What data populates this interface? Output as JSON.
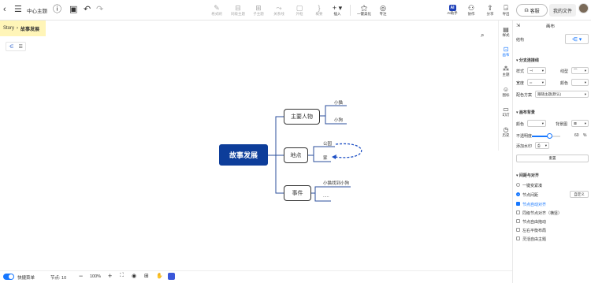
{
  "topbar": {
    "doc_title": "中心主题",
    "tools": [
      {
        "label": "格式刷",
        "enabled": false
      },
      {
        "label": "同级主题",
        "enabled": false
      },
      {
        "label": "子主题",
        "enabled": false
      },
      {
        "label": "关系线",
        "enabled": false
      },
      {
        "label": "外框",
        "enabled": false
      },
      {
        "label": "概要",
        "enabled": false
      },
      {
        "label": "插入",
        "enabled": true
      },
      {
        "label": "一键美化",
        "enabled": true
      },
      {
        "label": "专注",
        "enabled": true
      }
    ],
    "ai_label": "AI助手",
    "ai_badge": "AI",
    "collab_label": "协作",
    "share_label": "分享",
    "export_label": "导出",
    "share_btn": "客服",
    "files_btn": "我的文件"
  },
  "breadcrumb": {
    "root": "Story",
    "current": "故事发展"
  },
  "mindmap": {
    "root": "故事发展",
    "branches": [
      {
        "label": "主要人物",
        "children": [
          "小猫",
          "小狗"
        ]
      },
      {
        "label": "地点",
        "children": [
          "公园",
          "家"
        ]
      },
      {
        "label": "事件",
        "children": [
          "小猫找到小狗",
          "....."
        ]
      }
    ]
  },
  "right_tabs": [
    {
      "label": "样式",
      "active": false
    },
    {
      "label": "画布",
      "active": true
    },
    {
      "label": "主题",
      "active": false
    },
    {
      "label": "图标",
      "active": false
    },
    {
      "label": "幻灯",
      "active": false
    },
    {
      "label": "历史",
      "active": false
    }
  ],
  "panel": {
    "title": "画布",
    "structure_label": "结构",
    "branch_section": "分支连接线",
    "style_label": "样式",
    "line_label": "线型",
    "width_label": "宽度",
    "color_label": "颜色",
    "scheme_label": "配色方案",
    "scheme_value": "跟随主题(默认)",
    "canvas_section": "画布背景",
    "bg_color_label": "颜色",
    "bg_image_label": "背景图",
    "opacity_label": "不透明度",
    "opacity_value": "60",
    "opacity_unit": "%",
    "watermark_label": "添加水印",
    "reset_btn": "重置",
    "layout_section": "间距与对齐",
    "radio_unified": "一键变紧凑",
    "radio_node": "节点间距",
    "custom_btn": "自定义",
    "checks": [
      {
        "label": "节点自动对齐",
        "checked": true
      },
      {
        "label": "同级节点对齐（横竖）",
        "checked": false
      },
      {
        "label": "节点自由拖动",
        "checked": false
      },
      {
        "label": "左右平衡布局",
        "checked": false
      },
      {
        "label": "灵活自由主题",
        "checked": false
      }
    ]
  },
  "bottombar": {
    "quick_label": "快捷菜单",
    "node_count": "节点: 10",
    "zoom": "100%"
  }
}
